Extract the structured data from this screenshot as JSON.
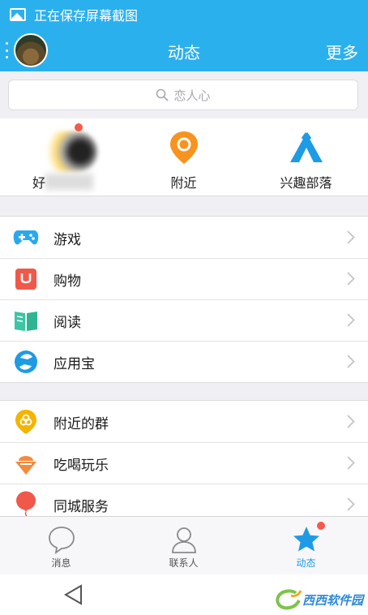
{
  "status_bar": {
    "text": "正在保存屏幕截图"
  },
  "header": {
    "title": "动态",
    "more_label": "更多"
  },
  "search": {
    "placeholder": "恋人心"
  },
  "shortcuts": [
    {
      "label": "好",
      "icon": "friend-avatar-icon"
    },
    {
      "label": "附近",
      "icon": "location-pin-icon",
      "color": "#f7931e"
    },
    {
      "label": "兴趣部落",
      "icon": "tent-icon",
      "color": "#1e9be5"
    }
  ],
  "list_groups": [
    [
      {
        "label": "游戏",
        "icon": "gamepad-icon",
        "color": "#2aa8ee"
      },
      {
        "label": "购物",
        "icon": "shopping-bag-icon",
        "color": "#f0584a"
      },
      {
        "label": "阅读",
        "icon": "book-icon",
        "color": "#3cc6a5"
      },
      {
        "label": "应用宝",
        "icon": "app-store-icon",
        "color": "#1e9be5"
      }
    ],
    [
      {
        "label": "附近的群",
        "icon": "nearby-group-icon",
        "color": "#f4b400"
      },
      {
        "label": "吃喝玩乐",
        "icon": "ice-cream-icon",
        "color": "#f58a3c"
      },
      {
        "label": "同城服务",
        "icon": "balloon-icon",
        "color": "#f0584a"
      }
    ]
  ],
  "tabs": [
    {
      "label": "消息",
      "icon": "chat-bubble-icon",
      "active": false
    },
    {
      "label": "联系人",
      "icon": "contacts-icon",
      "active": false
    },
    {
      "label": "动态",
      "icon": "star-icon",
      "active": true
    }
  ],
  "colors": {
    "primary": "#2bb0ee",
    "active_tab": "#1f9be6",
    "badge": "#f35b4a"
  },
  "watermark": {
    "text": "西西软件园"
  }
}
